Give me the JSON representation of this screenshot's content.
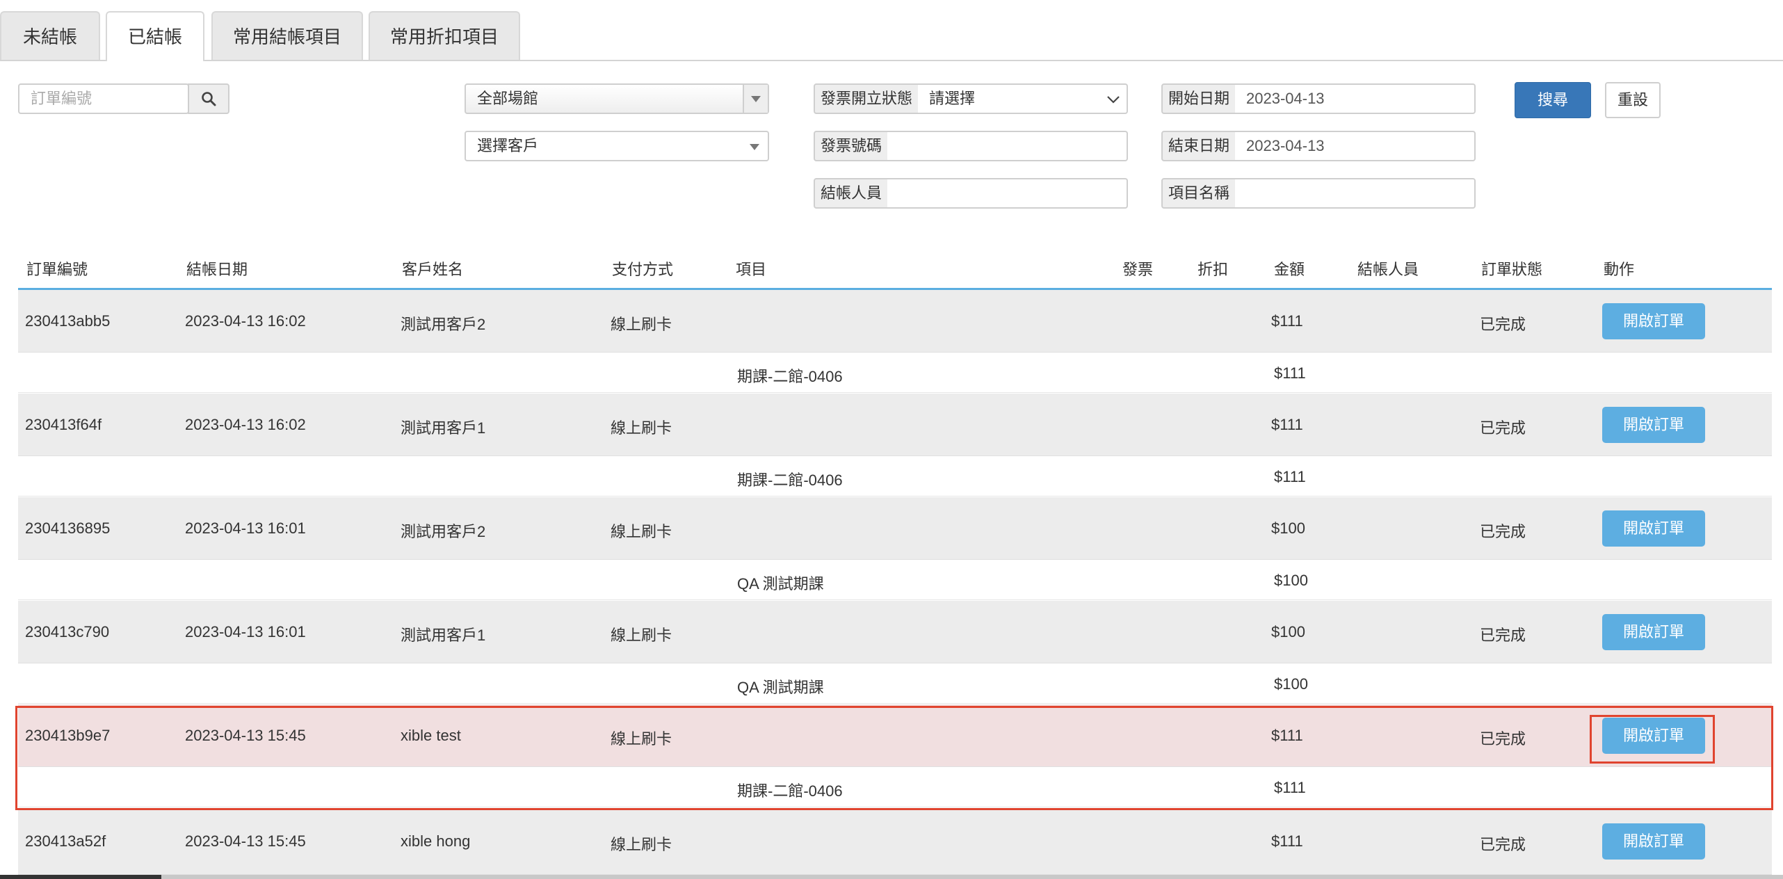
{
  "tabs": [
    "未結帳",
    "已結帳",
    "常用結帳項目",
    "常用折扣項目"
  ],
  "search": {
    "order_placeholder": "訂單編號",
    "venue": "全部場館",
    "customer": "選擇客戶",
    "invoice_status_label": "發票開立狀態",
    "invoice_status_value": "請選擇",
    "invoice_no_label": "發票號碼",
    "invoice_no_value": "",
    "cashier_label": "結帳人員",
    "cashier_value": "",
    "start_label": "開始日期",
    "start_value": "2023-04-13",
    "end_label": "結束日期",
    "end_value": "2023-04-13",
    "item_label": "項目名稱",
    "item_value": "",
    "search_btn": "搜尋",
    "reset_btn": "重設"
  },
  "table": {
    "headers": [
      "訂單編號",
      "結帳日期",
      "客戶姓名",
      "支付方式",
      "項目",
      "發票",
      "折扣",
      "金額",
      "結帳人員",
      "訂單狀態",
      "動作"
    ],
    "orders": [
      {
        "id": "230413abb5",
        "date": "2023-04-13 16:02",
        "customer": "測試用客戶2",
        "payment": "線上刷卡",
        "amount": "$111",
        "status": "已完成",
        "action": "開啟訂單",
        "item": "期課-二館-0406",
        "item_amount": "$111"
      },
      {
        "id": "230413f64f",
        "date": "2023-04-13 16:02",
        "customer": "測試用客戶1",
        "payment": "線上刷卡",
        "amount": "$111",
        "status": "已完成",
        "action": "開啟訂單",
        "item": "期課-二館-0406",
        "item_amount": "$111"
      },
      {
        "id": "2304136895",
        "date": "2023-04-13 16:01",
        "customer": "測試用客戶2",
        "payment": "線上刷卡",
        "amount": "$100",
        "status": "已完成",
        "action": "開啟訂單",
        "item": "QA 測試期課",
        "item_amount": "$100"
      },
      {
        "id": "230413c790",
        "date": "2023-04-13 16:01",
        "customer": "測試用客戶1",
        "payment": "線上刷卡",
        "amount": "$100",
        "status": "已完成",
        "action": "開啟訂單",
        "item": "QA 測試期課",
        "item_amount": "$100"
      },
      {
        "id": "230413b9e7",
        "date": "2023-04-13 15:45",
        "customer": "xible test",
        "payment": "線上刷卡",
        "amount": "$111",
        "status": "已完成",
        "action": "開啟訂單",
        "item": "期課-二館-0406",
        "item_amount": "$111"
      },
      {
        "id": "230413a52f",
        "date": "2023-04-13 15:45",
        "customer": "xible hong",
        "payment": "線上刷卡",
        "amount": "$111",
        "status": "已完成",
        "action": "開啟訂單"
      }
    ]
  },
  "colors": {
    "accent": "#3877b8",
    "open_button": "#5daee1",
    "highlight": "#e0442f",
    "header_line": "#5aaee0"
  }
}
